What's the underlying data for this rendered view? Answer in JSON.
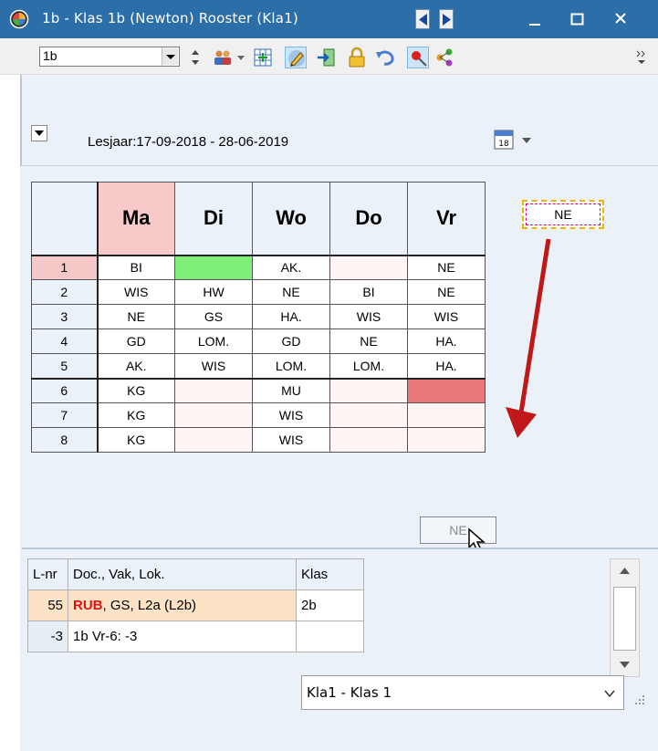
{
  "window": {
    "title": "1b - Klas 1b (Newton)  Rooster  (Kla1)",
    "title_bar_color": "#2b6ea8"
  },
  "toolbar": {
    "class_value": "1b",
    "icons": [
      "spin-icon",
      "people-icon",
      "grid-icon",
      "pencil-icon",
      "exit-icon",
      "lock-icon",
      "undo-icon",
      "pin-icon",
      "share-icon",
      "more-icon"
    ]
  },
  "period": {
    "label": "Lesjaar:17-09-2018 - 28-06-2019"
  },
  "timetable": {
    "days": [
      "Ma",
      "Di",
      "Wo",
      "Do",
      "Vr"
    ],
    "periods": [
      "1",
      "2",
      "3",
      "4",
      "5",
      "6",
      "7",
      "8"
    ],
    "rows": [
      [
        "BI",
        "",
        "AK.",
        "",
        "NE"
      ],
      [
        "WIS",
        "HW",
        "NE",
        "BI",
        "NE"
      ],
      [
        "NE",
        "GS",
        "HA.",
        "WIS",
        "WIS"
      ],
      [
        "GD",
        "LOM.",
        "GD",
        "NE",
        "HA."
      ],
      [
        "AK.",
        "WIS",
        "LOM.",
        "LOM.",
        "HA."
      ],
      [
        "KG",
        "",
        "MU",
        "",
        ""
      ],
      [
        "KG",
        "",
        "WIS",
        "",
        ""
      ],
      [
        "KG",
        "",
        "WIS",
        "",
        ""
      ]
    ],
    "colors": {
      "today": "#f8c9c9",
      "green_slot": "#7ef07a",
      "drop_target": "#e8767a",
      "arrow": "#c01818"
    }
  },
  "drag": {
    "floating_label": "NE",
    "ghost_label": "NE"
  },
  "lessons": {
    "headers": [
      "L-nr",
      "Doc., Vak, Lok.",
      "Klas"
    ],
    "rows": [
      {
        "nr": "55",
        "teacher": "RUB",
        "rest": ", GS, L2a (L2b)",
        "klas": "2b"
      },
      {
        "nr": "-3",
        "teacher": "",
        "rest": "1b Vr-6: -3",
        "klas": ""
      }
    ]
  },
  "footer": {
    "class_select": "Kla1 - Klas 1"
  }
}
